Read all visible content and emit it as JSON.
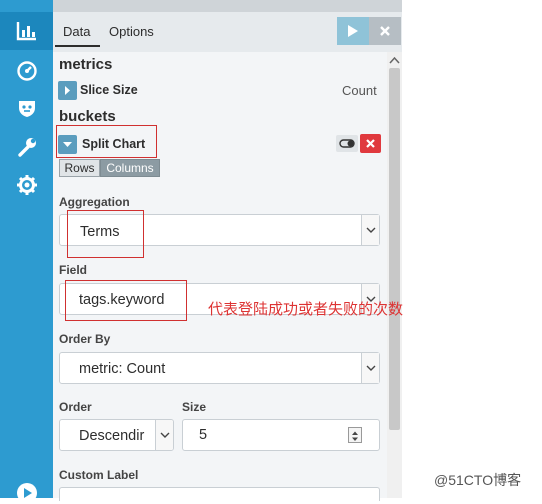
{
  "tabs": [
    {
      "label": "Data"
    },
    {
      "label": "Options"
    }
  ],
  "metrics": {
    "heading": "metrics",
    "slice_label": "Slice Size",
    "slice_value": "Count"
  },
  "buckets": {
    "heading": "buckets",
    "split_label": "Split Chart",
    "rows_label": "Rows",
    "columns_label": "Columns"
  },
  "aggregation": {
    "label": "Aggregation",
    "value": "Terms"
  },
  "field": {
    "label": "Field",
    "value": "tags.keyword"
  },
  "order_by": {
    "label": "Order By",
    "value": "metric: Count"
  },
  "order": {
    "label": "Order",
    "value": "Descendir"
  },
  "size": {
    "label": "Size",
    "value": "5"
  },
  "custom_label": {
    "label": "Custom Label"
  },
  "annotation": "代表登陆成功或者失败的次数",
  "watermark": "@51CTO博客",
  "colors": {
    "nav": "#2d9bd0",
    "accent": "#5b9dbe",
    "danger": "#e0393e"
  }
}
